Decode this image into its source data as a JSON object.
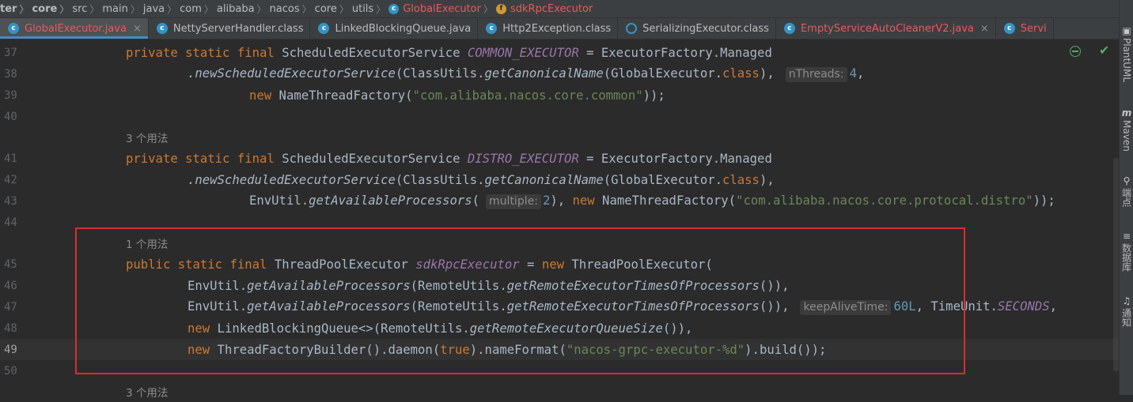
{
  "breadcrumb": [
    "ter",
    "core",
    "src",
    "main",
    "java",
    "com",
    "alibaba",
    "nacos",
    "core",
    "utils",
    "GlobalExecutor",
    "sdkRpcExecutor"
  ],
  "tabs": [
    {
      "label": "GlobalExecutor.java",
      "icon": "class-icon",
      "close": "×"
    },
    {
      "label": "NettyServerHandler.class",
      "icon": "class-icon"
    },
    {
      "label": "LinkedBlockingQueue.java",
      "icon": "class-icon"
    },
    {
      "label": "Http2Exception.class",
      "icon": "class-icon"
    },
    {
      "label": "SerializingExecutor.class",
      "icon": "class-icon"
    },
    {
      "label": "EmptyServiceAutoCleanerV2.java",
      "icon": "class-icon",
      "close": "×"
    },
    {
      "label": "Servi",
      "icon": "class-icon"
    }
  ],
  "toolwindows": {
    "plantuml": "PlantUML",
    "maven": "Maven",
    "maven_glyph": "m",
    "endpoints": "端点",
    "database": "数据库",
    "notifications": "通知"
  },
  "lines": {
    "n37": "37",
    "n38": "38",
    "n39": "39",
    "n40": "40",
    "n41": "41",
    "n42": "42",
    "n43": "43",
    "n44": "44",
    "n45": "45",
    "n46": "46",
    "n47": "47",
    "n48": "48",
    "n49": "49",
    "n50": "50",
    "usage3": "3 个用法",
    "usage1": "1 个用法"
  },
  "code": {
    "private": "private",
    "static": "static",
    "final": "final",
    "public": "public",
    "new": "new",
    "class_kw": "class",
    "true_kw": "true",
    "ses": "ScheduledExecutorService",
    "tpe_type": "ThreadPoolExecutor",
    "common_executor": "COMMON_EXECUTOR",
    "distro_executor": "DISTRO_EXECUTOR",
    "sdk_rpc_executor": "sdkRpcExecutor",
    "eq_factory_managed": " = ExecutorFactory.Managed",
    "new_sched": ".newScheduledExecutorService",
    "classutils": "(ClassUtils.",
    "get_canonical": "getCanonicalName",
    "global_exec": "(GlobalExecutor.",
    "close_comma": "),",
    "hint_nthreads": "nThreads:",
    "num4": "4",
    "name_tf": " NameThreadFactory(",
    "str_common": "\"com.alibaba.nacos.core.common\"",
    "close_paren_semi": "));",
    "envutil": "EnvUtil.",
    "get_avail": "getAvailableProcessors",
    "open_paren": "(",
    "hint_multiple": "multiple:",
    "num2": "2",
    "str_distro": "\"com.alibaba.nacos.core.protocal.distro\"",
    "eq_new_sp": " = ",
    "tpe_open": " ThreadPoolExecutor(",
    "remote_utils": "(RemoteUtils.",
    "get_times": "getRemoteExecutorTimesOfProcessors",
    "close3": "()),",
    "hint_keepalive": "keepAliveTime:",
    "num60": "60L",
    "timeunit": ", TimeUnit.",
    "seconds": "SECONDS",
    "trailing_comma": ",",
    "lbq": " LinkedBlockingQueue<>(RemoteUtils.",
    "get_queue": "getRemoteExecutorQueueSize",
    "tfb": " ThreadFactoryBuilder().daemon(",
    "name_format": ").nameFormat(",
    "str_fmt": "\"nacos-grpc-executor-%d\"",
    "build_end": ").build());"
  },
  "status": {
    "check": "✔"
  }
}
